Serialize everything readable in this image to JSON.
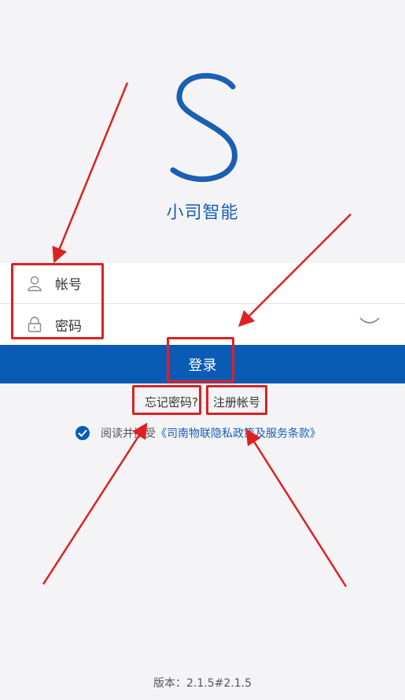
{
  "app": {
    "logo_letter": "S",
    "name": "小司智能"
  },
  "form": {
    "account_label": "帐号",
    "account_value": "",
    "password_label": "密码",
    "password_value": ""
  },
  "actions": {
    "login_label": "登录",
    "forgot_label": "忘记密码?",
    "register_label": "注册帐号"
  },
  "agreement": {
    "prefix": "阅读并接受",
    "policy": "《司南物联隐私政策及服务条款》",
    "checked": true
  },
  "footer": {
    "version": "版本：2.1.5#2.1.5"
  },
  "icons": {
    "account": "user-icon",
    "password": "lock-icon",
    "visibility": "eye-closed-icon",
    "agree": "check-circle-icon"
  },
  "colors": {
    "brand": "#0a5bb5",
    "annotation": "#e02020",
    "background": "#f4f4f6"
  }
}
